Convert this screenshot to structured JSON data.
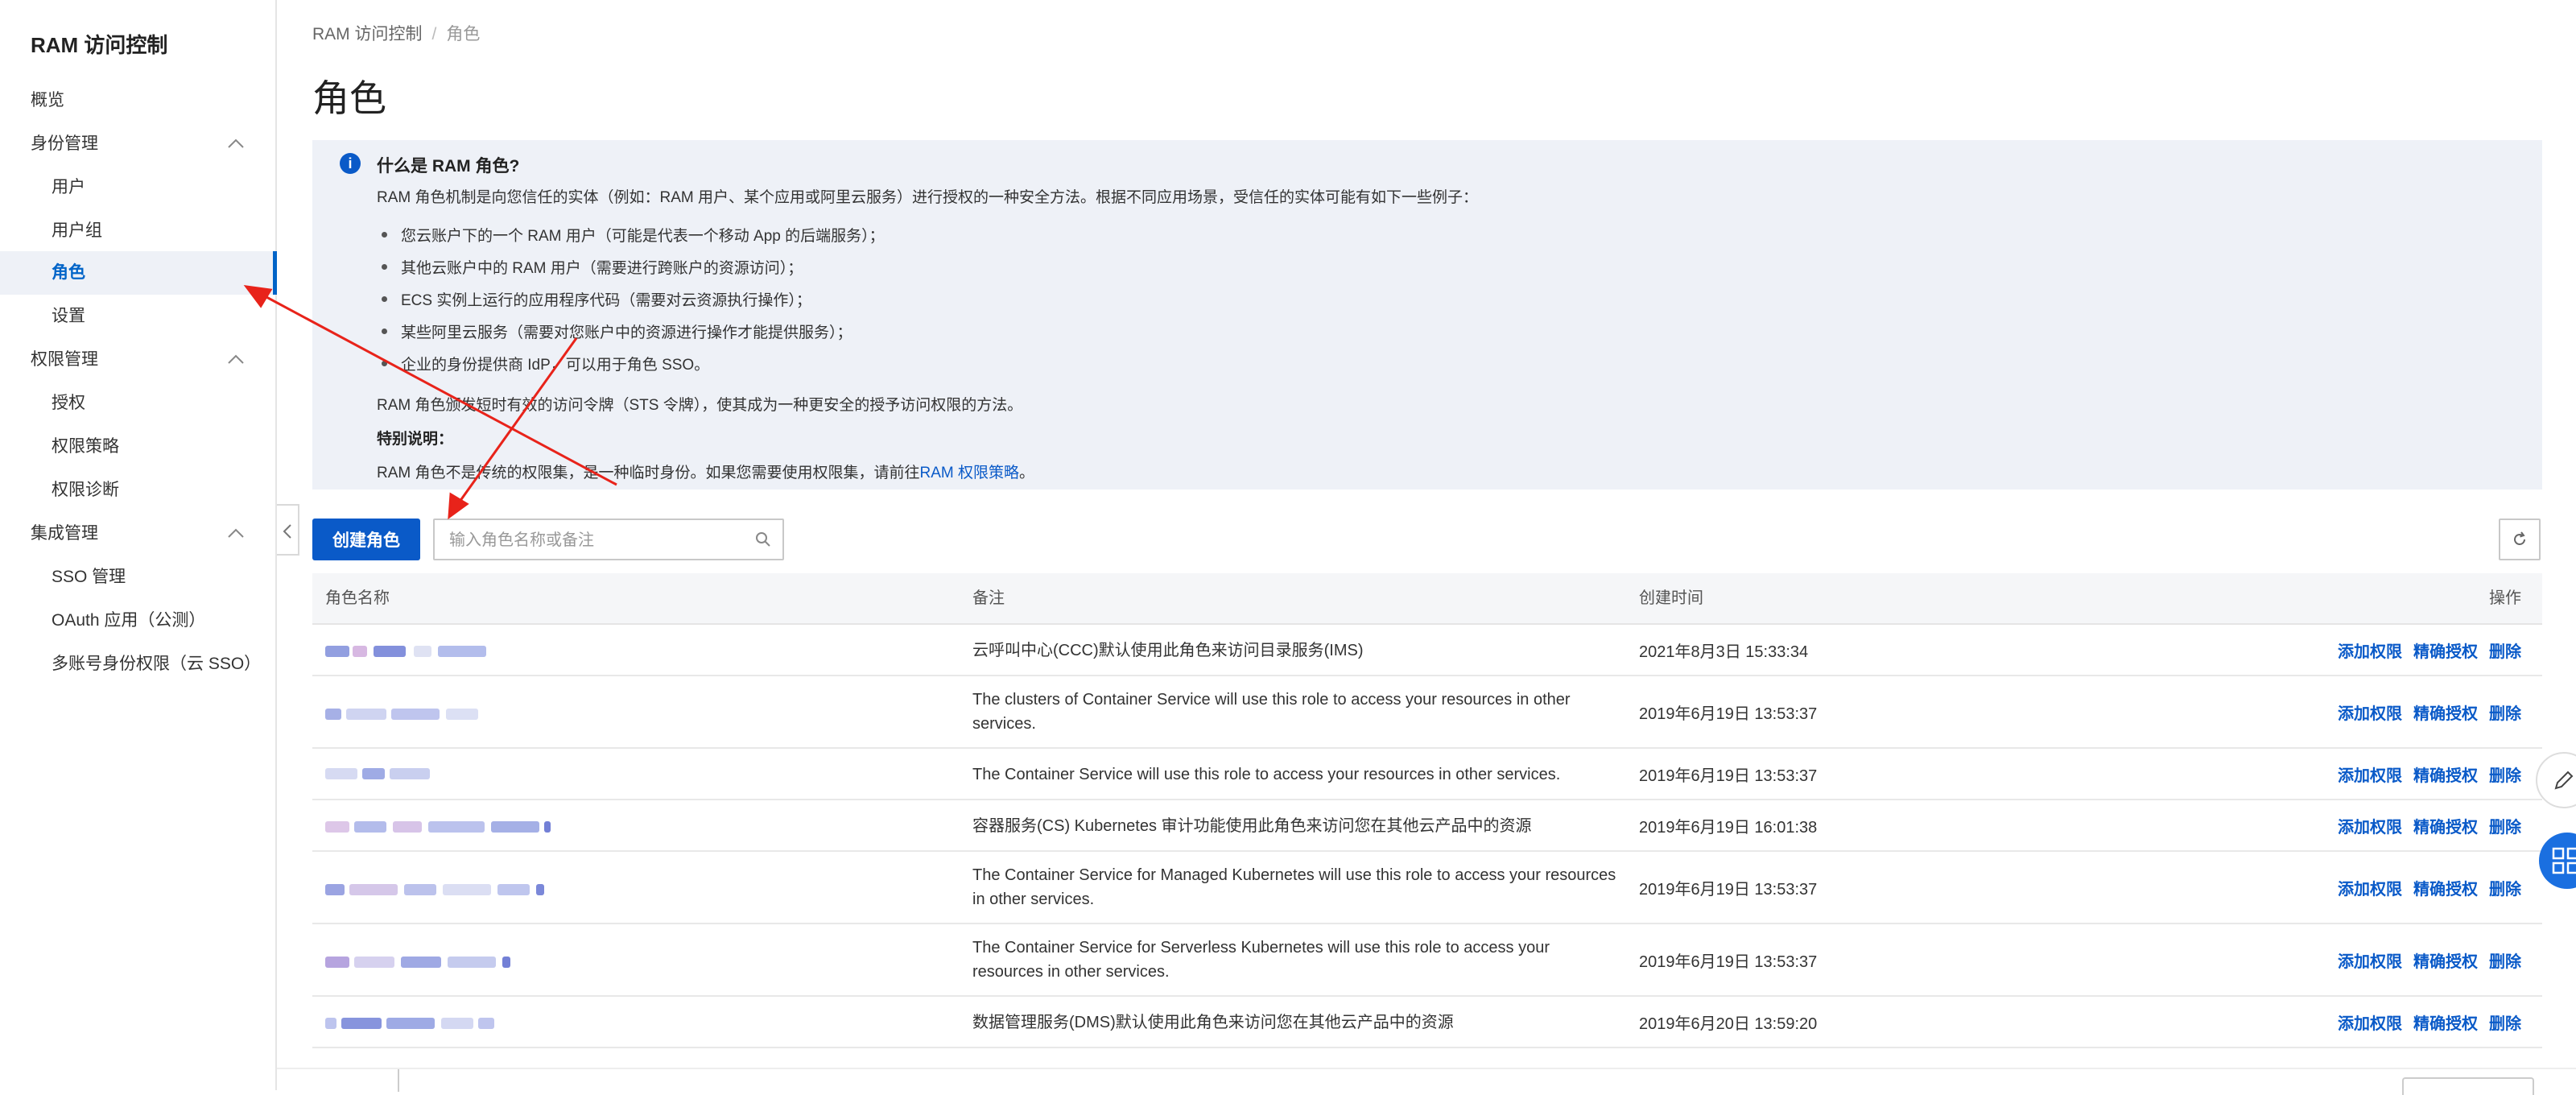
{
  "sidebar": {
    "title": "RAM 访问控制",
    "items": [
      {
        "label": "概览"
      },
      {
        "label": "身份管理"
      },
      {
        "label": "用户"
      },
      {
        "label": "用户组"
      },
      {
        "label": "角色"
      },
      {
        "label": "设置"
      },
      {
        "label": "权限管理"
      },
      {
        "label": "授权"
      },
      {
        "label": "权限策略"
      },
      {
        "label": "权限诊断"
      },
      {
        "label": "集成管理"
      },
      {
        "label": "SSO 管理"
      },
      {
        "label": "OAuth 应用（公测）"
      },
      {
        "label": "多账号身份权限（云 SSO）"
      }
    ]
  },
  "breadcrumb": {
    "root": "RAM 访问控制",
    "sep": "/",
    "current": "角色"
  },
  "page_title": "角色",
  "info": {
    "icon": "i",
    "title": "什么是 RAM 角色?",
    "intro": "RAM 角色机制是向您信任的实体（例如：RAM 用户、某个应用或阿里云服务）进行授权的一种安全方法。根据不同应用场景，受信任的实体可能有如下一些例子：",
    "bullets": [
      "您云账户下的一个 RAM 用户（可能是代表一个移动 App 的后端服务）；",
      "其他云账户中的 RAM 用户（需要进行跨账户的资源访问）；",
      "ECS 实例上运行的应用程序代码（需要对云资源执行操作）；",
      "某些阿里云服务（需要对您账户中的资源进行操作才能提供服务）；",
      "企业的身份提供商 IdP，可以用于角色 SSO。"
    ],
    "sts_line": "RAM 角色颁发短时有效的访问令牌（STS 令牌），使其成为一种更安全的授予访问权限的方法。",
    "special_label": "特别说明：",
    "special_text": "RAM 角色不是传统的权限集，是一种临时身份。如果您需要使用权限集，请前往",
    "special_link": "RAM 权限策略",
    "special_end": "。"
  },
  "toolbar": {
    "create_label": "创建角色",
    "search_placeholder": "输入角色名称或备注"
  },
  "table": {
    "columns": [
      "角色名称",
      "备注",
      "创建时间",
      "操作"
    ],
    "rows": [
      {
        "note": "云呼叫中心(CCC)默认使用此角色来访问目录服务(IMS)",
        "time": "2021年8月3日 15:33:34"
      },
      {
        "note": "The clusters of Container Service will use this role to access your resources in other services.",
        "time": "2019年6月19日 13:53:37"
      },
      {
        "note": "The Container Service will use this role to access your resources in other services.",
        "time": "2019年6月19日 13:53:37"
      },
      {
        "note": "容器服务(CS) Kubernetes 审计功能使用此角色来访问您在其他云产品中的资源",
        "time": "2019年6月19日 16:01:38"
      },
      {
        "note": "The Container Service for Managed Kubernetes will use this role to access your resources in other services.",
        "time": "2019年6月19日 13:53:37"
      },
      {
        "note": "The Container Service for Serverless Kubernetes will use this role to access your resources in other services.",
        "time": "2019年6月19日 13:53:37"
      },
      {
        "note": "数据管理服务(DMS)默认使用此角色来访问您在其他云产品中的资源",
        "time": "2019年6月20日 13:59:20"
      }
    ],
    "actions": [
      "添加权限",
      "精确授权",
      "删除"
    ]
  },
  "colors": {
    "primary": "#0a5ac8",
    "info_bg": "#eef1f7",
    "annotation": "#e8231a"
  }
}
